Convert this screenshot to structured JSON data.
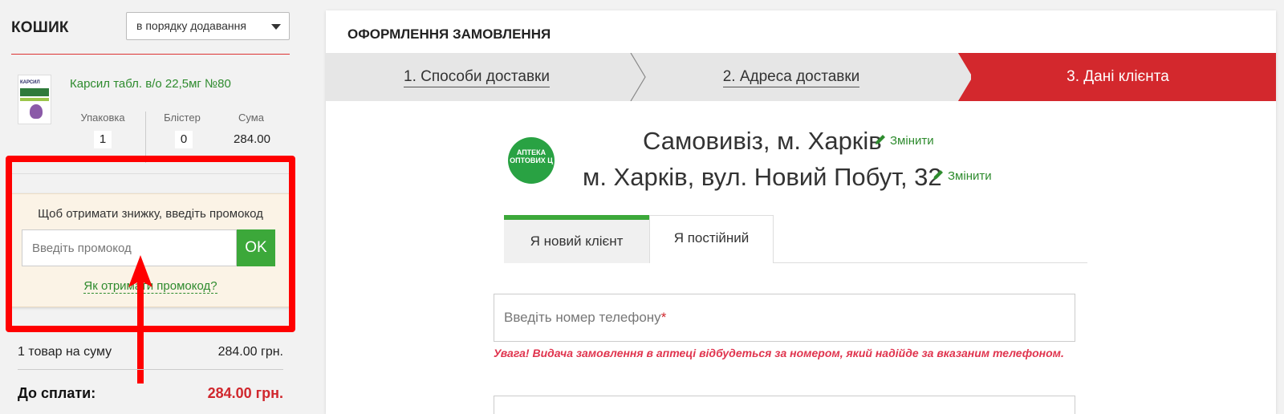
{
  "cart": {
    "title": "КОШИК",
    "sort_selected": "в порядку додавання",
    "item": {
      "name": "Карсил табл. в/о 22,5мг №80",
      "thumb_text": "КАРСИЛ",
      "col_pack": "Упаковка",
      "col_blister": "Блістер",
      "col_sum": "Сума",
      "qty_pack": "1",
      "qty_blister": "0",
      "sum": "284.00"
    },
    "promo": {
      "text": "Щоб отримати знижку, введіть промокод",
      "placeholder": "Введіть промокод",
      "ok_label": "OK",
      "link": "Як отримати промокод?"
    },
    "summary_label": "1 товар на суму",
    "summary_value": "284.00 грн.",
    "total_label": "До сплати:",
    "total_value": "284.00 грн."
  },
  "checkout": {
    "title": "ОФОРМЛЕННЯ ЗАМОВЛЕННЯ",
    "steps": [
      {
        "label": "1. Способи доставки"
      },
      {
        "label": "2. Адреса доставки"
      },
      {
        "label": "3. Дані клієнта"
      }
    ],
    "logo_text": "АПТЕКА ОПТОВИХ Ц",
    "pickup": "Самовивіз, м. Харків",
    "address": "м. Харків, вул. Новий Побут, 32",
    "edit_label": "Змінити",
    "tabs": [
      {
        "label": "Я новий клієнт"
      },
      {
        "label": "Я постійний"
      }
    ],
    "phone_placeholder": "Введіть номер телефону",
    "required_mark": "*",
    "warning": "Увага! Видача замовлення в аптеці відбудеться за номером, який надійде за вказаним телефоном."
  },
  "colors": {
    "accent_red": "#d3282d",
    "accent_green": "#3ca83a",
    "highlight": "#ff0000"
  }
}
